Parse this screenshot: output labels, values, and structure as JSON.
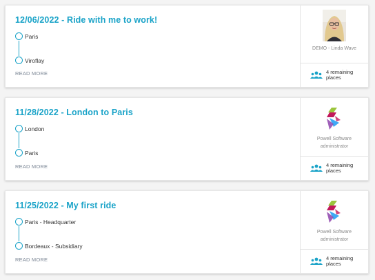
{
  "rides": [
    {
      "title": "12/06/2022 - Ride with me to work!",
      "from": "Paris",
      "to": "Viroflay",
      "read_more": "READ MORE",
      "driver": "DEMO - Linda Wave",
      "driver_avatar": "person-photo",
      "places": "4 remaining places"
    },
    {
      "title": "11/28/2022 - London to Paris",
      "from": "London",
      "to": "Paris",
      "read_more": "READ MORE",
      "driver": "Powell Software administrator",
      "driver_avatar": "powell-logo",
      "places": "4 remaining places"
    },
    {
      "title": "11/25/2022 - My first ride",
      "from": "Paris - Headquarter",
      "to": "Bordeaux - Subsidiary",
      "read_more": "READ MORE",
      "driver": "Powell Software administrator",
      "driver_avatar": "powell-logo",
      "places": "4 remaining places"
    }
  ],
  "colors": {
    "accent": "#1aa3c8",
    "logo_green": "#9bc53d",
    "logo_magenta": "#c2185b",
    "logo_blue": "#3fa9f5",
    "logo_purple": "#8e44ad"
  }
}
